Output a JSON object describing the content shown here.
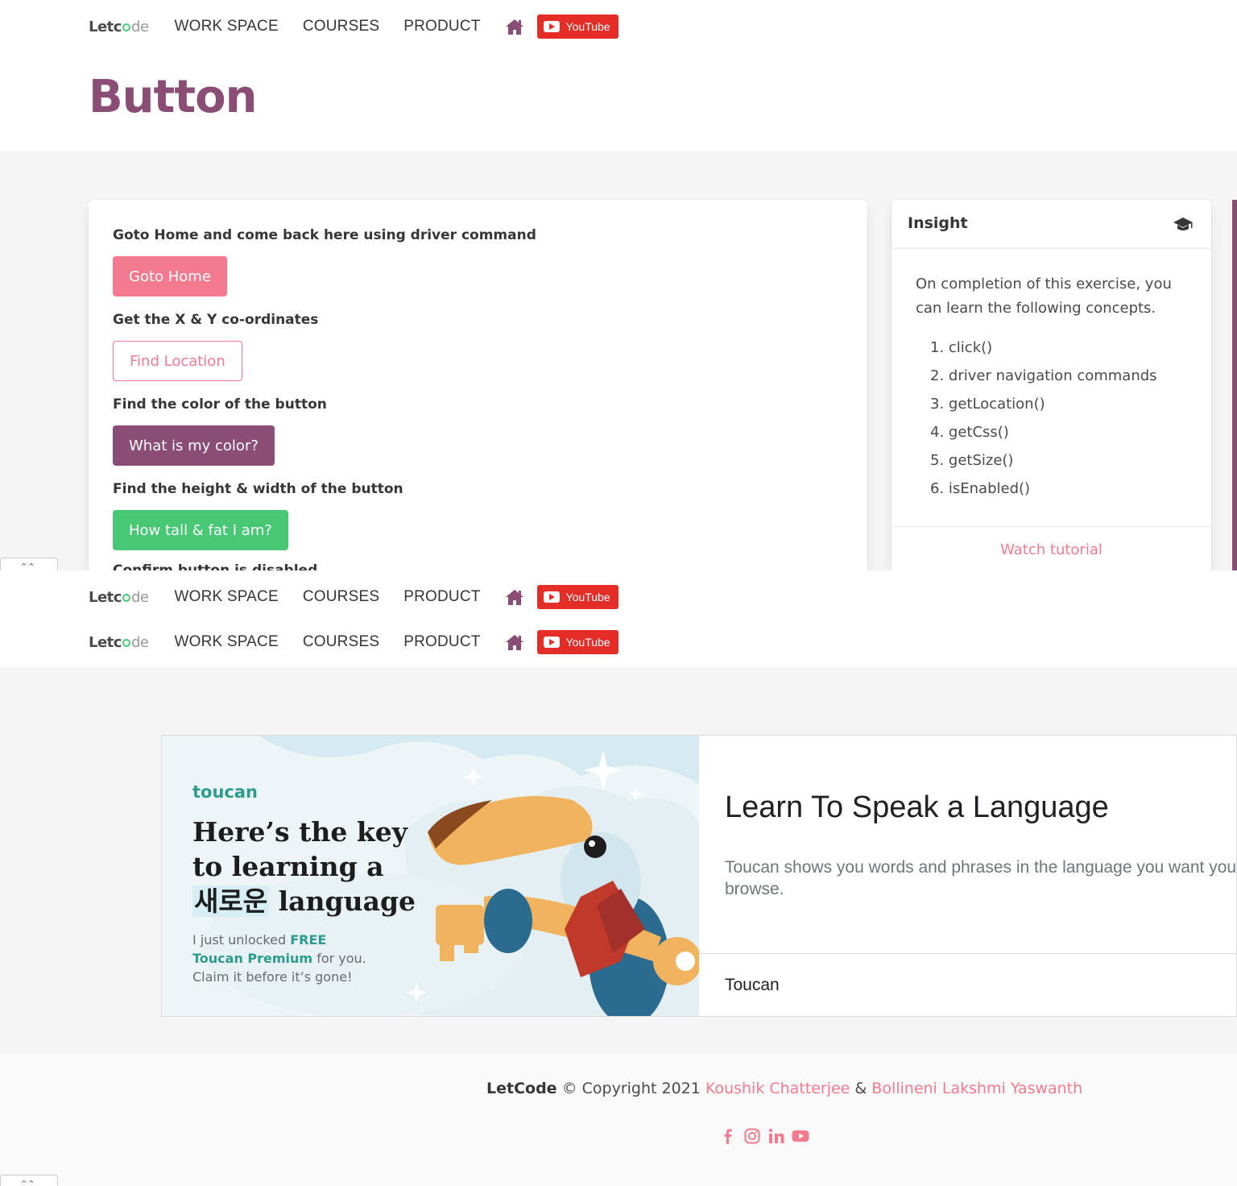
{
  "nav": {
    "logo_left": "Letc",
    "logo_right": "de",
    "links": [
      "WORK SPACE",
      "COURSES",
      "PRODUCT"
    ],
    "youtube_label": "YouTube",
    "home_icon": "home-icon"
  },
  "page_title": "Button",
  "exercises": [
    {
      "label": "Goto Home and come back here using driver command",
      "button": "Goto Home"
    },
    {
      "label": "Get the X & Y co-ordinates",
      "button": "Find Location"
    },
    {
      "label": "Find the color of the button",
      "button": "What is my color?"
    },
    {
      "label": "Find the height & width of the button",
      "button": "How tall & fat I am?"
    }
  ],
  "clipped_label": "Confirm button is disabled",
  "insight": {
    "title": "Insight",
    "icon": "graduation-cap-icon",
    "intro": "On completion of this exercise, you can learn the following concepts.",
    "concepts": [
      "1. click()",
      "2. driver navigation commands",
      "3. getLocation()",
      "4. getCss()",
      "5. getSize()",
      "6. isEnabled()"
    ],
    "tutorial_link": "Watch tutorial"
  },
  "ad": {
    "logo": "toucan",
    "headline_1": "Here’s the key",
    "headline_2": "to learning a",
    "headline_korean": "새로운",
    "headline_3": "language",
    "small_1": "I just unlocked ",
    "small_free": "FREE",
    "small_premium": "Toucan Premium",
    "small_2": " for you.",
    "small_3": "Claim it before it’s gone!",
    "title": "Learn To Speak a Language",
    "description": "Toucan shows you words and phrases in the language you want you browse.",
    "brand": "Toucan"
  },
  "footer": {
    "brand": "LetCode",
    "copyright": " © Copyright 2021 ",
    "author_1": "Koushik Chatterjee",
    "amp": " & ",
    "author_2": "Bollineni Lakshmi Yaswanth",
    "socials": [
      "facebook-icon",
      "instagram-icon",
      "linkedin-icon",
      "youtube-icon"
    ]
  },
  "colors": {
    "primary_purple": "#8a4d76",
    "danger_pink": "#f47a8f",
    "success_green": "#48c774",
    "youtube_red": "#e52d27"
  }
}
